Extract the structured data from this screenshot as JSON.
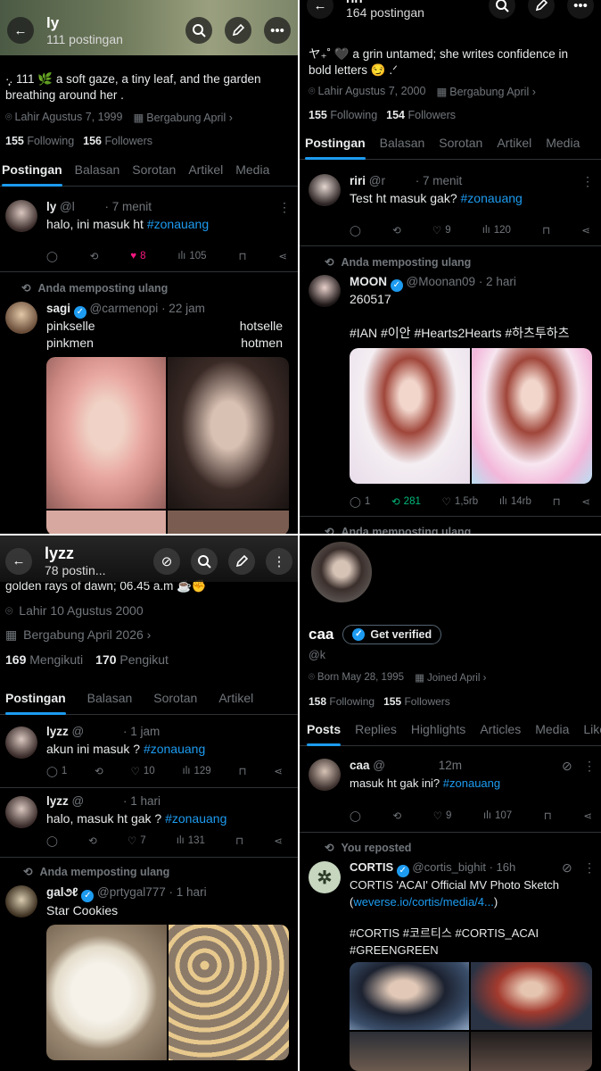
{
  "panel1": {
    "header": {
      "name": "ly",
      "posts": "111 postingan"
    },
    "bio": "·̩͙. 111 🌿 a soft gaze, a tiny leaf, and the garden breathing around her .",
    "birth": "Lahir Agustus 7, 1999",
    "joined": "Bergabung April",
    "following_count": "155",
    "following_label": "Following",
    "followers_count": "156",
    "followers_label": "Followers",
    "tabs": [
      "Postingan",
      "Balasan",
      "Sorotan",
      "Artikel",
      "Media"
    ],
    "post1": {
      "name": "ly",
      "handle": "@l",
      "time": "· 7 menit",
      "text_prefix": "halo, ini masuk ht ",
      "hashtag": "#zonauang",
      "likes": "8",
      "views": "105"
    },
    "repost_note": "Anda memposting ulang",
    "post2": {
      "name": "sagi",
      "handle": "@carmenopi",
      "time": "· 22 jam",
      "l1a": "pinkselle",
      "l1b": "hotselle",
      "l2a": "pinkmen",
      "l2b": "hotmen"
    }
  },
  "panel2": {
    "header": {
      "name": "riri",
      "posts": "164 postingan"
    },
    "bio": "ヤ₊˚ 🖤 a grin untamed; she writes confidence in bold letters 😏 .ᐟ",
    "birth": "Lahir Agustus 7, 2000",
    "joined": "Bergabung April",
    "following_count": "155",
    "following_label": "Following",
    "followers_count": "154",
    "followers_label": "Followers",
    "tabs": [
      "Postingan",
      "Balasan",
      "Sorotan",
      "Artikel",
      "Media"
    ],
    "post1": {
      "name": "riri",
      "handle": "@r",
      "time": "· 7 menit",
      "text_prefix": "Test ht masuk gak? ",
      "hashtag": "#zonauang",
      "likes": "9",
      "views": "120"
    },
    "repost_note": "Anda memposting ulang",
    "post2": {
      "name": "MOON",
      "handle": "@Moonan09",
      "time": "· 2 hari",
      "text": "260517",
      "hashtags": "#IAN #이안 #Hearts2Hearts #하츠투하츠",
      "replies": "1",
      "reposts": "281",
      "likes": "1,5rb",
      "views": "14rb"
    },
    "repost_note2": "Anda memposting ulang"
  },
  "panel3": {
    "header": {
      "name": "lyzz",
      "posts": "78 postin..."
    },
    "bio_cut": "golden rays of dawn; 06.45 a.m ☕✊",
    "birth": "Lahir 10 Agustus 2000",
    "joined": "Bergabung April 2026",
    "following_count": "169",
    "following_label": "Mengikuti",
    "followers_count": "170",
    "followers_label": "Pengikut",
    "tabs": [
      "Postingan",
      "Balasan",
      "Sorotan",
      "Artikel"
    ],
    "post1": {
      "name": "lyzz",
      "handle": "@",
      "time": "· 1 jam",
      "text_prefix": "akun ini masuk ? ",
      "hashtag": "#zonauang",
      "replies": "1",
      "likes": "10",
      "views": "129"
    },
    "post2": {
      "name": "lyzz",
      "handle": "@",
      "time": "· 1 hari",
      "text_prefix": "halo, masuk ht gak ? ",
      "hashtag": "#zonauang",
      "likes": "7",
      "views": "131"
    },
    "repost_note": "Anda memposting ulang",
    "post3": {
      "name": "gal૭ℓ",
      "handle": "@prtygal777",
      "time": "· 1 hari",
      "text": "Star Cookies"
    }
  },
  "panel4": {
    "name": "caa",
    "verify": "Get verified",
    "handle": "@k",
    "birth": "Born May 28, 1995",
    "joined": "Joined April",
    "following_count": "158",
    "following_label": "Following",
    "followers_count": "155",
    "followers_label": "Followers",
    "tabs": [
      "Posts",
      "Replies",
      "Highlights",
      "Articles",
      "Media",
      "Likes"
    ],
    "post1": {
      "name": "caa",
      "handle": "@",
      "time": "12m",
      "text_prefix": "masuk ht gak ini? ",
      "hashtag": "#zonauang",
      "likes": "9",
      "views": "107"
    },
    "repost_note": "You reposted",
    "post2": {
      "name": "CORTIS",
      "handle": "@cortis_bighit",
      "time": "· 16h",
      "text": "CORTIS 'ACAI' Official MV Photo Sketch",
      "link": "weverse.io/cortis/media/4...",
      "link_open": "(",
      "link_close": ")",
      "hashtags1": "#CORTIS #코르티스 #CORTIS_ACAI",
      "hashtags2": "#GREENGREEN"
    }
  },
  "colors": {
    "accent": "#1d9bf0",
    "like": "#f91880",
    "repost": "#00ba7c",
    "muted": "#71767b"
  }
}
